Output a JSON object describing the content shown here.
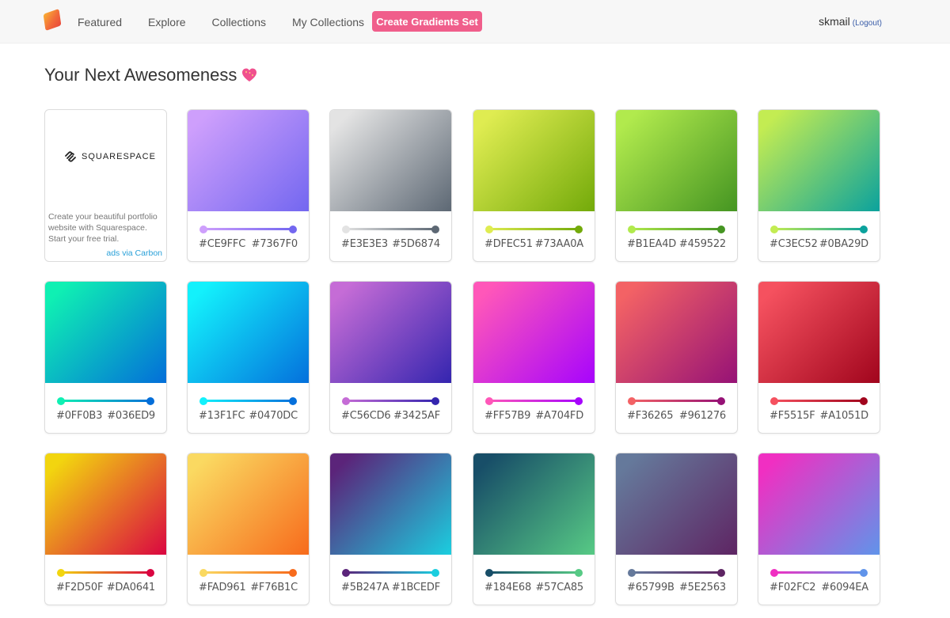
{
  "nav": {
    "items": [
      "Featured",
      "Explore",
      "Collections",
      "My Collections"
    ],
    "cta": "Create Gradients Set",
    "user": "skmail",
    "logout": "(Logout)"
  },
  "page": {
    "title": "Your Next Awesomeness"
  },
  "ad": {
    "brand": "SQUARESPACE",
    "text": "Create your beautiful portfolio website with Squarespace. Start your free trial.",
    "via": "ads via Carbon"
  },
  "gradients": [
    {
      "from": "#CE9FFC",
      "to": "#7367F0"
    },
    {
      "from": "#E3E3E3",
      "to": "#5D6874"
    },
    {
      "from": "#DFEC51",
      "to": "#73AA0A"
    },
    {
      "from": "#B1EA4D",
      "to": "#459522"
    },
    {
      "from": "#C3EC52",
      "to": "#0BA29D"
    },
    {
      "from": "#0FF0B3",
      "to": "#036ED9"
    },
    {
      "from": "#13F1FC",
      "to": "#0470DC"
    },
    {
      "from": "#C56CD6",
      "to": "#3425AF"
    },
    {
      "from": "#FF57B9",
      "to": "#A704FD"
    },
    {
      "from": "#F36265",
      "to": "#961276"
    },
    {
      "from": "#F5515F",
      "to": "#A1051D"
    },
    {
      "from": "#F2D50F",
      "to": "#DA0641"
    },
    {
      "from": "#FAD961",
      "to": "#F76B1C"
    },
    {
      "from": "#5B247A",
      "to": "#1BCEDF"
    },
    {
      "from": "#184E68",
      "to": "#57CA85"
    },
    {
      "from": "#65799B",
      "to": "#5E2563"
    },
    {
      "from": "#F02FC2",
      "to": "#6094EA"
    }
  ]
}
